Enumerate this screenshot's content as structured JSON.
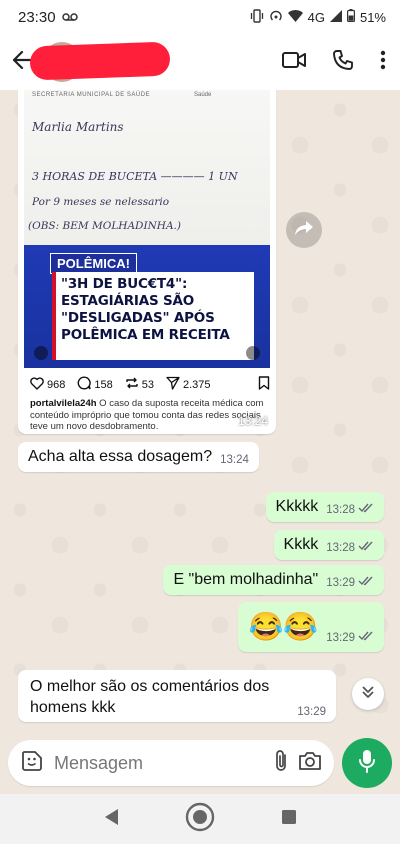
{
  "status": {
    "time": "23:30",
    "network": "4G",
    "battery": "51%"
  },
  "media_post": {
    "paper_header_left": "SECRETARIA MUNICIPAL DE SAÚDE",
    "paper_header_right": "Saúde",
    "handwriting": {
      "line1": "Marlia Martins",
      "line2": "3 HORAS  DE  BUCETA ———— 1 UN",
      "line3": "Por 9  meses se nelessario",
      "line4": "(OBS: BEM  MOLHADINHA.)"
    },
    "tag": "POLÊMICA!",
    "headline": "\"3H DE BUC€T4\": ESTAGIÁRIAS SÃO \"DESLIGADAS\" APÓS POLÊMICA EM RECEITA",
    "likes": "968",
    "comments": "158",
    "reposts": "53",
    "shares": "2.375",
    "caption_user": "portalvilela24h",
    "caption_text": "O caso da suposta receita médica com conteúdo impróprio que tomou conta das redes sociais teve um novo desdobramento.",
    "time": "13:24"
  },
  "messages": [
    {
      "dir": "in",
      "text": "Acha alta essa dosagem?",
      "time": "13:24"
    },
    {
      "dir": "out",
      "text": "Kkkkk",
      "time": "13:28"
    },
    {
      "dir": "out",
      "text": "Kkkk",
      "time": "13:28"
    },
    {
      "dir": "out",
      "text": "E \"bem molhadinha\"",
      "time": "13:29"
    },
    {
      "dir": "out",
      "text": "😂😂",
      "time": "13:29"
    },
    {
      "dir": "in",
      "text": "O melhor são os comentários dos homens kkk",
      "time": "13:29"
    }
  ],
  "composer": {
    "placeholder": "Mensagem"
  },
  "colors": {
    "header_bg": "#ffffff",
    "chat_bg": "#efe7de",
    "out_bubble": "#d9fdd3",
    "in_bubble": "#ffffff",
    "accent_green": "#1daa61",
    "redaction": "#ff1f3a"
  },
  "icons": [
    "back-arrow-icon",
    "video-call-icon",
    "phone-icon",
    "menu-dots-icon",
    "share-forward-icon",
    "sticker-icon",
    "attach-icon",
    "camera-icon",
    "mic-icon",
    "chevron-double-down-icon",
    "nav-back-icon",
    "nav-home-icon",
    "nav-recents-icon",
    "double-check-icon"
  ]
}
